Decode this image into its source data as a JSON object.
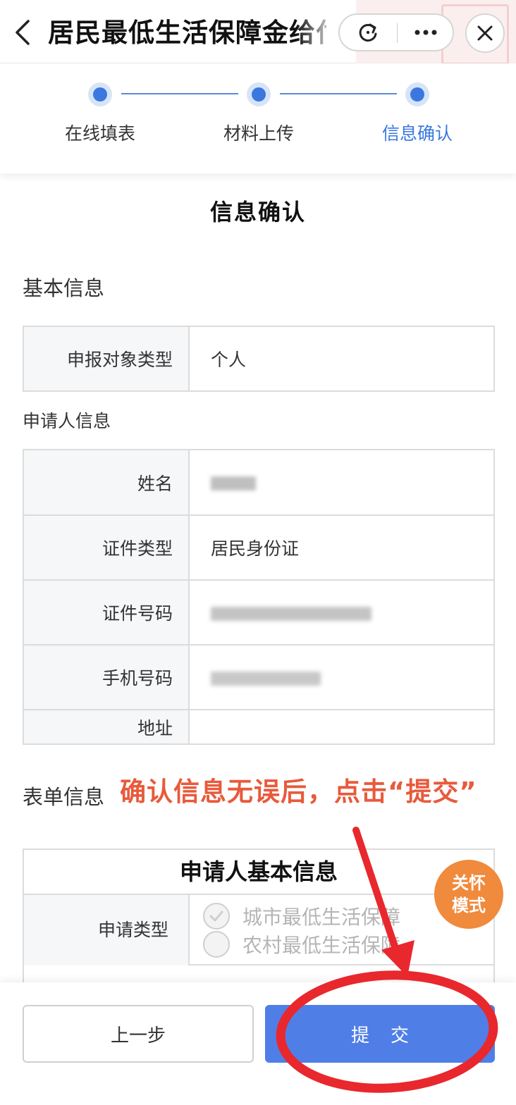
{
  "header": {
    "title": "居民最低生活保障金给付",
    "icons": {
      "back": "chevron-left-icon",
      "refresh": "refresh-icon",
      "more": "more-dots-icon",
      "close": "close-icon"
    }
  },
  "stepper": {
    "steps": [
      {
        "label": "在线填表"
      },
      {
        "label": "材料上传"
      },
      {
        "label": "信息确认"
      }
    ],
    "active_index": 2,
    "accent_color": "#3a78e0"
  },
  "page_heading": "信息确认",
  "basic_info": {
    "section_title": "基本信息",
    "rows": [
      {
        "key": "申报对象类型",
        "value": "个人"
      }
    ]
  },
  "applicant_info": {
    "section_title": "申请人信息",
    "rows": [
      {
        "key": "姓名",
        "value": ""
      },
      {
        "key": "证件类型",
        "value": "居民身份证"
      },
      {
        "key": "证件号码",
        "value": ""
      },
      {
        "key": "手机号码",
        "value": ""
      },
      {
        "key": "地址",
        "value": ""
      }
    ]
  },
  "form_info": {
    "section_title": "表单信息",
    "annotation": "确认信息无误后，点击“提交”",
    "annotation_color": "#e85a3c",
    "table_header": "申请人基本信息",
    "application_type": {
      "key": "申请类型",
      "options": [
        {
          "label": "城市最低生活保障",
          "checked": true
        },
        {
          "label": "农村最低生活保障",
          "checked": false
        }
      ]
    }
  },
  "care_mode": {
    "label_line1": "关怀",
    "label_line2": "模式",
    "color": "#f08a3c"
  },
  "footer": {
    "prev_label": "上一步",
    "submit_label": "提交",
    "submit_color": "#4f7fe6"
  }
}
